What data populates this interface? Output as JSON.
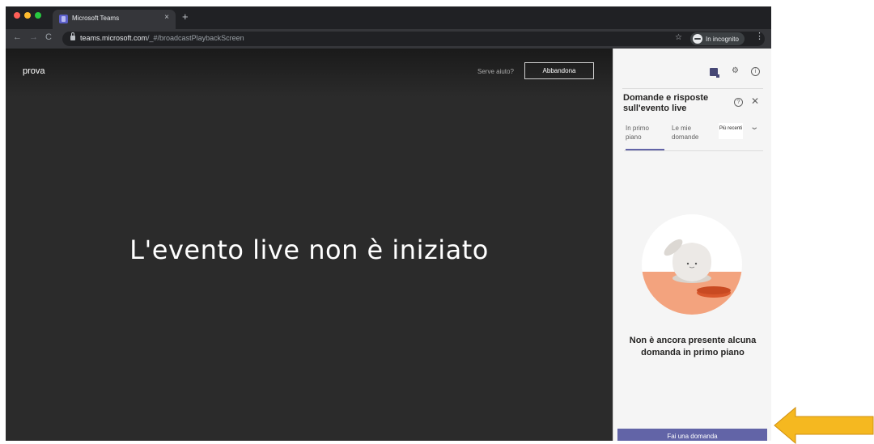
{
  "browser": {
    "tab_title": "Microsoft Teams",
    "tab_close": "×",
    "new_tab": "+",
    "url_host": "teams.microsoft.com",
    "url_path": "/_#/broadcastPlaybackScreen",
    "incognito_label": "In incognito"
  },
  "stage": {
    "event_name": "prova",
    "help_link": "Serve aiuto?",
    "leave_button": "Abbandona",
    "status_message": "L'evento live non è iniziato"
  },
  "qna": {
    "title": "Domande e risposte sull'evento live",
    "tabs": [
      {
        "label": "In primo piano",
        "selected": true
      },
      {
        "label": "Le mie domande",
        "selected": false
      }
    ],
    "sort_selected": "Più recenti",
    "empty_message": "Non è ancora presente alcuna domanda in primo piano",
    "ask_button": "Fai una domanda"
  },
  "colors": {
    "accent": "#6264a7",
    "stage_bg": "#2b2b2b",
    "panel_bg": "#f5f5f5",
    "arrow": "#f5b820"
  },
  "icons": [
    "back-icon",
    "forward-icon",
    "reload-icon",
    "lock-icon",
    "star-icon",
    "incognito-icon",
    "menu-icon",
    "qna-icon",
    "gear-icon",
    "info-icon",
    "help-icon",
    "close-icon",
    "chevron-down-icon"
  ]
}
